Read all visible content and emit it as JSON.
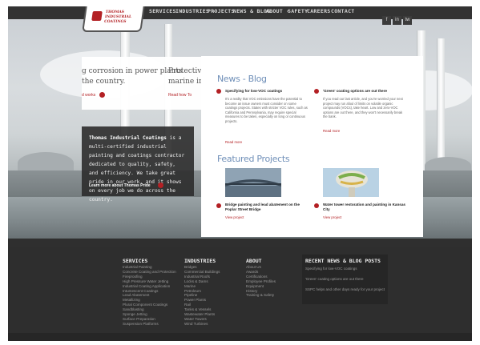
{
  "nav": {
    "items": [
      "SERVICES -",
      "INDUSTRIES -",
      "PROJECTS",
      "NEWS & BLOG",
      "ABOUT -",
      "SAFETY",
      "CAREERS",
      "CONTACT"
    ],
    "social": [
      "f",
      "in",
      "tw"
    ]
  },
  "logo": {
    "line1": "THOMAS",
    "line2": "INDUSTRIAL",
    "line3": "COATINGS"
  },
  "hero_cards": {
    "news_line1": "g corrosion in power plants",
    "news_line2": "the country.",
    "news_link": "d works",
    "news2_line1": "Protectiv",
    "news2_line2": "marine ir",
    "news2_link": "Read how To",
    "about_bold": "Thomas Industrial Coatings",
    "about_text": " is a multi-certified industrial painting and coatings contractor dedicated to quality, safety, and efficiency. We take great pride in our work, and it shows on every job we do across the country.",
    "about_link": "Learn more about Thomas Pride"
  },
  "panel": {
    "news_title": "News - Blog",
    "news": [
      {
        "title": "Specifying for low-VOC coatings",
        "body": "It's a reality that VOC emissions have the potential to become an issue owners must consider on some coatings projects. States with stricter VOC rules, such as California and Pennsylvania, may require special measures to be taken, especially on long or continuous projects.",
        "link": "Read more"
      },
      {
        "title": "'Green' coating options are out there",
        "body": "If you read our last article, and you're worried your next project may run afoul of limits on volatile organic compounds (VOCs), take heart. Low and zero-VOC options are out there, and they won't necessarily break the bank.",
        "link": "Read more"
      }
    ],
    "projects_title": "Featured Projects",
    "projects": [
      {
        "title": "Bridge painting and lead abatement on the Poplar Street Bridge",
        "link": "View project"
      },
      {
        "title": "Water tower restoration and painting in Kansas City",
        "link": "View project"
      }
    ]
  },
  "footer": {
    "services_title": "SERVICES",
    "services": [
      "Industrial Painting",
      "Concrete Coating and Protection",
      "Fireproofing",
      "High Pressure Water Jetting",
      "Industrial Coating Application",
      "Intumescent Coatings",
      "Lead Abatement",
      "Metallizing",
      "Plural Component Coatings",
      "Sandblasting",
      "Sponge Jetting",
      "Surface Preparation",
      "Suspension Platforms"
    ],
    "industries_title": "INDUSTRIES",
    "industries": [
      "Bridges",
      "Commercial Buildings",
      "Industrial Roofs",
      "Locks & Dams",
      "Marine",
      "Petroleum",
      "Pipeline",
      "Power Plants",
      "Rail",
      "Tanks & Vessels",
      "Wastewater Plants",
      "Water Towers",
      "Wind Turbines"
    ],
    "about_title": "ABOUT",
    "about": [
      "About Us",
      "Awards",
      "Certifications",
      "Employee Profiles",
      "Equipment",
      "History",
      "Training & Safety"
    ],
    "recent_title": "RECENT NEWS & BLOG POSTS",
    "recent": [
      "Specifying for low-VOC coatings",
      "'Green' coating options are out there",
      "SSPC helps and other days ready for your project"
    ]
  },
  "colors": {
    "accent_red": "#b32024",
    "title_blue": "#6f8fb8",
    "footer_bg": "#2e2e2e"
  }
}
